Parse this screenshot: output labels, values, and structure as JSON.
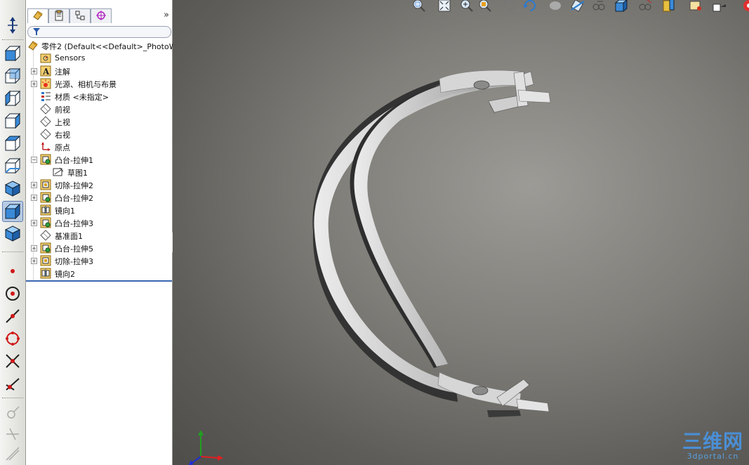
{
  "feature_manager": {
    "tabs": [
      {
        "icon": "feature-tree-icon"
      },
      {
        "icon": "property-manager-icon"
      },
      {
        "icon": "configuration-manager-icon"
      },
      {
        "icon": "dimxpert-icon"
      }
    ],
    "expand_glyph": "»",
    "root": "零件2  (Default<<Default>_PhotoWo",
    "items": [
      {
        "label": "Sensors",
        "icon": "sensors-icon",
        "expandable": false
      },
      {
        "label": "注解",
        "icon": "annotations-icon",
        "expandable": true
      },
      {
        "label": "光源、相机与布景",
        "icon": "lights-cameras-icon",
        "expandable": true
      },
      {
        "label": "材质 <未指定>",
        "icon": "material-icon",
        "expandable": false
      },
      {
        "label": "前视",
        "icon": "plane-icon",
        "expandable": false
      },
      {
        "label": "上视",
        "icon": "plane-icon",
        "expandable": false
      },
      {
        "label": "右视",
        "icon": "plane-icon",
        "expandable": false
      },
      {
        "label": "原点",
        "icon": "origin-icon",
        "expandable": false
      },
      {
        "label": "凸台-拉伸1",
        "icon": "boss-extrude-icon",
        "expandable": true,
        "expanded": true
      },
      {
        "label": "草图1",
        "icon": "sketch-icon",
        "expandable": false,
        "child": true
      },
      {
        "label": "切除-拉伸2",
        "icon": "cut-extrude-icon",
        "expandable": true
      },
      {
        "label": "凸台-拉伸2",
        "icon": "boss-extrude-icon",
        "expandable": true
      },
      {
        "label": "镜向1",
        "icon": "mirror-icon",
        "expandable": false
      },
      {
        "label": "凸台-拉伸3",
        "icon": "boss-extrude-icon",
        "expandable": true
      },
      {
        "label": "基准面1",
        "icon": "plane-icon",
        "expandable": false
      },
      {
        "label": "凸台-拉伸5",
        "icon": "boss-extrude-icon",
        "expandable": true
      },
      {
        "label": "切除-拉伸3",
        "icon": "cut-extrude-icon",
        "expandable": true
      },
      {
        "label": "镜向2",
        "icon": "mirror-icon",
        "expandable": false
      }
    ]
  },
  "left_toolbar": {
    "buttons": [
      "normal-to-icon",
      "front-view-icon",
      "back-view-icon",
      "left-view-icon",
      "right-view-icon",
      "top-view-icon",
      "bottom-view-icon",
      "isometric-view-icon",
      "shaded-view-icon",
      "trimetric-view-icon",
      "point-icon",
      "circle-point-icon",
      "line-icon",
      "circle-icon",
      "intersect-icon",
      "angle-line-icon",
      "ghost-tool-1-icon",
      "ghost-tool-2-icon",
      "ghost-tool-3-icon"
    ],
    "active": "shaded-view-icon"
  },
  "heads_up_toolbar": {
    "buttons": [
      "zoom-to-area-icon",
      "zoom-to-fit-icon",
      "zoom-in-out-icon",
      "zoom-selection-icon",
      "rotate-icon",
      "pan-icon",
      "previous-view-icon",
      "section-view-icon",
      "view-orientation-icon",
      "display-style-icon",
      "hide-show-icon",
      "edit-appearance-icon",
      "apply-scene-icon",
      "view-settings-icon",
      "realview-icon"
    ]
  },
  "watermark": {
    "title": "三维网",
    "subtitle": "3dportal.cn"
  },
  "triad": {
    "x_color": "#e02020",
    "y_color": "#20a020",
    "z_color": "#2030d0"
  },
  "colors": {
    "accent": "#3a66b0",
    "part": "#c8c8c8"
  }
}
